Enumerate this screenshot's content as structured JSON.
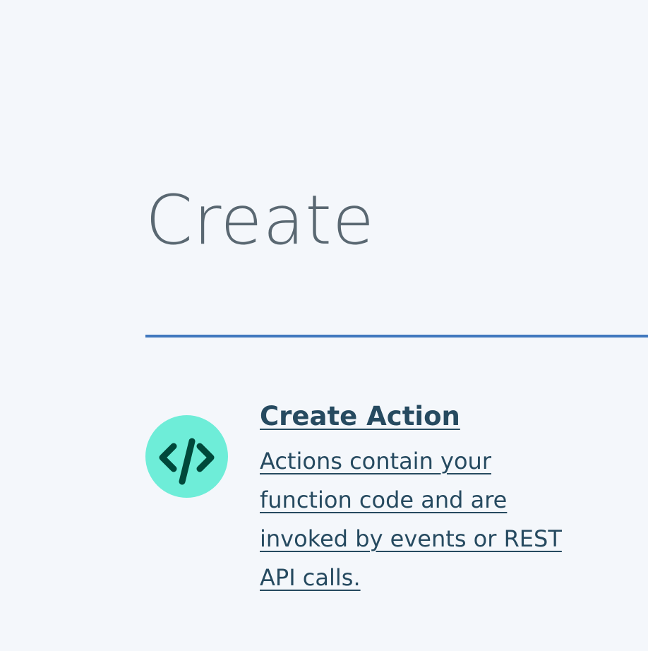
{
  "page": {
    "title": "Create"
  },
  "cards": [
    {
      "icon": "code-icon",
      "title": "Create Action",
      "description": "Actions contain your function code and are invoked by events or REST API calls."
    }
  ],
  "colors": {
    "background": "#f4f7fb",
    "title_text": "#5a6872",
    "rule": "#4178be",
    "link_text": "#264a60",
    "icon_bg": "#6eedd8",
    "icon_fg": "#00483a"
  }
}
